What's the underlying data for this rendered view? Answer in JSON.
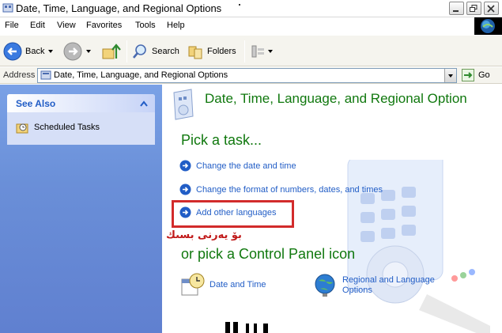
{
  "window": {
    "title": "Date, Time, Language, and Regional Options"
  },
  "menu": [
    "File",
    "Edit",
    "View",
    "Favorites",
    "Tools",
    "Help"
  ],
  "toolbar": {
    "back_label": "Back",
    "search_label": "Search",
    "folders_label": "Folders"
  },
  "address": {
    "label": "Address",
    "value": "Date, Time, Language, and Regional Options",
    "go_label": "Go"
  },
  "see_also": {
    "title": "See Also",
    "items": [
      "Scheduled Tasks"
    ]
  },
  "main": {
    "title": "Date, Time, Language, and Regional Option",
    "pick_task": "Pick a task...",
    "tasks": [
      "Change the date and time",
      "Change the format of numbers, dates, and times",
      "Add other languages"
    ],
    "annotation": "بۆ يەرنى بسىك",
    "pick_icon": "or pick a Control Panel icon",
    "icons": [
      {
        "label": "Date and Time"
      },
      {
        "label_line1": "Regional and Language",
        "label_line2": "Options"
      }
    ]
  },
  "colors": {
    "heading_green": "#10780e",
    "link_blue": "#215dc6",
    "highlight_red": "#d22b2b",
    "sidebar_blue": "#6a8fd8"
  }
}
